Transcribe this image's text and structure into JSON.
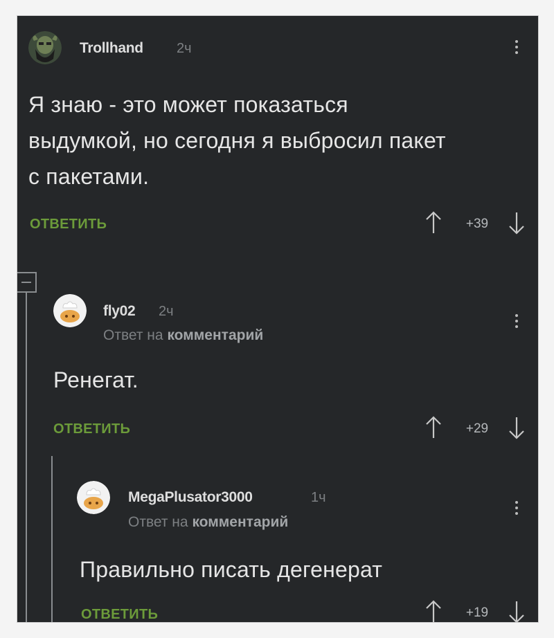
{
  "comments": [
    {
      "author": "Trollhand",
      "time": "2ч",
      "text_lines": [
        "Я знаю - это может показаться",
        "выдумкой, но сегодня я выбросил пакет",
        "с пакетами."
      ],
      "reply_label": "ОТВЕТИТЬ",
      "score": "+39",
      "avatar_icon": "bearded-man-avatar-icon"
    },
    {
      "author": "fly02",
      "time": "2ч",
      "reply_to_prefix": "Ответ на",
      "reply_to_link": "комментарий",
      "text": "Ренегат.",
      "reply_label": "ОТВЕТИТЬ",
      "score": "+29",
      "avatar_icon": "default-chef-avatar-icon"
    },
    {
      "author": "MegaPlusator3000",
      "time": "1ч",
      "reply_to_prefix": "Ответ на",
      "reply_to_link": "комментарий",
      "text": "Правильно писать дегенерат",
      "reply_label": "ОТВЕТИТЬ",
      "score": "+19",
      "avatar_icon": "default-chef-avatar-icon"
    }
  ],
  "colors": {
    "background": "#252729",
    "accent_green": "#6c9b3a",
    "text": "#e6e6e6",
    "muted": "#7d8083"
  }
}
